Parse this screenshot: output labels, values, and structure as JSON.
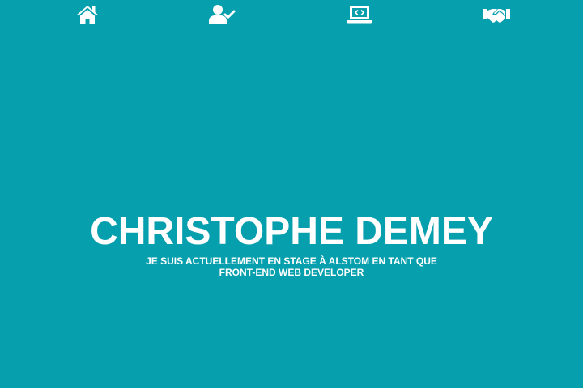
{
  "colors": {
    "background": "#069fad",
    "foreground": "#ffffff"
  },
  "nav": {
    "items": [
      {
        "icon": "home-icon"
      },
      {
        "icon": "user-check-icon"
      },
      {
        "icon": "laptop-code-icon"
      },
      {
        "icon": "handshake-icon"
      }
    ]
  },
  "hero": {
    "name": "CHRISTOPHE DEMEY",
    "subtitle": "JE SUIS ACTUELLEMENT EN STAGE À ALSTOM EN TANT QUE FRONT-END WEB DEVELOPER"
  }
}
